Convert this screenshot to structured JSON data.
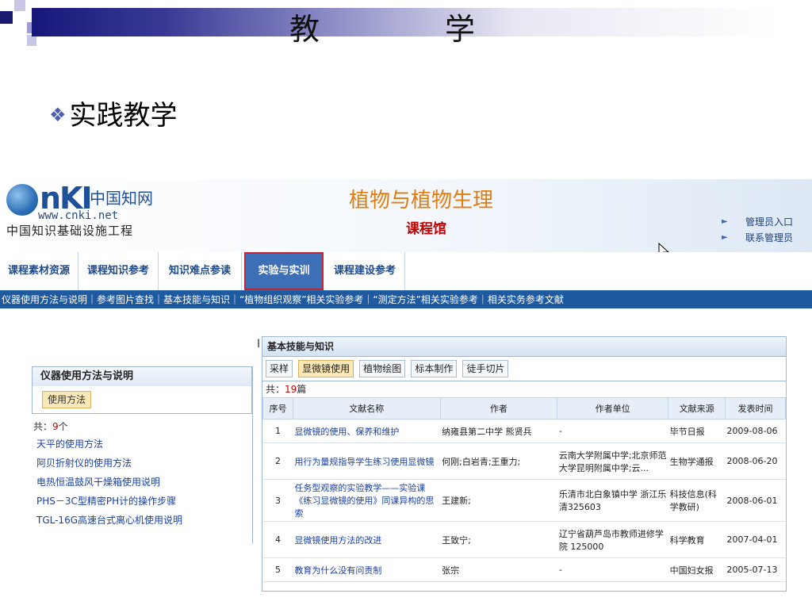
{
  "slide": {
    "title": "教　学",
    "bullet": "实践教学",
    "bullet_icon": "diamond-bullet-icon"
  },
  "site": {
    "logo_nk": "nKI",
    "logo_cn": "中国知网",
    "logo_url": "www.cnki.net",
    "logo_sub": "中国知识基础设施工程",
    "title": "植物与植物生理",
    "subtitle": "课程馆",
    "admin_links": [
      "管理员入口",
      "联系管理员"
    ]
  },
  "nav": {
    "tabs": [
      "课程素材资源",
      "课程知识参考",
      "知识难点参读",
      "实验与实训",
      "课程建设参考"
    ],
    "active": "实验与实训",
    "sub": "仪器使用方法与说明｜参考图片查找｜基本技能与知识｜“植物组织观察”相关实验参考｜“测定方法”相关实验参考｜相关实务参考文献"
  },
  "left_panel": {
    "title": "仪器使用方法与说明",
    "button": "使用方法",
    "count_prefix": "共：",
    "count_value": "9",
    "count_suffix": "个",
    "items": [
      "天平的使用方法",
      "阿贝折射仪的使用方法",
      "电热恒温鼓风干燥箱使用说明",
      "PHS－3C型精密PH计的操作步骤",
      "TGL-16G高速台式离心机使用说明"
    ]
  },
  "right_panel": {
    "title": "基本技能与知识",
    "tabs": [
      "采样",
      "显微镜使用",
      "植物绘图",
      "标本制作",
      "徒手切片"
    ],
    "active_tab": "显微镜使用",
    "count_prefix": "共：",
    "count_value": "19",
    "count_suffix": "篇",
    "columns": [
      "序号",
      "文献名称",
      "作者",
      "作者单位",
      "文献来源",
      "发表时间"
    ],
    "rows": [
      {
        "no": "1",
        "title": "显微镜的使用、保养和维护",
        "author": "纳雍县第二中学 熊贤兵",
        "unit": "-",
        "source": "毕节日报",
        "date": "2009-08-06"
      },
      {
        "no": "2",
        "title": "用行为量规指导学生练习使用显微镜",
        "author": "何刚;白岩青;王重力;",
        "unit": "云南大学附属中学;北京师范大学昆明附属中学;云...",
        "source": "生物学通报",
        "date": "2008-06-20"
      },
      {
        "no": "3",
        "title": "任务型观察的实验教学——实验课《练习显微镜的使用》同课异构的思索",
        "author": "王建新;",
        "unit": "乐清市北白象镇中学 浙江乐清325603",
        "source": "科技信息(科学教研)",
        "date": "2008-06-01"
      },
      {
        "no": "4",
        "title": "显微镜使用方法的改进",
        "author": "王致宁;",
        "unit": "辽宁省葫芦岛市教师进修学院 125000",
        "source": "科学教育",
        "date": "2007-04-01"
      },
      {
        "no": "5",
        "title": "教育为什么没有问责制",
        "author": "张宗",
        "unit": "-",
        "source": "中国妇女报",
        "date": "2005-07-13"
      }
    ]
  }
}
